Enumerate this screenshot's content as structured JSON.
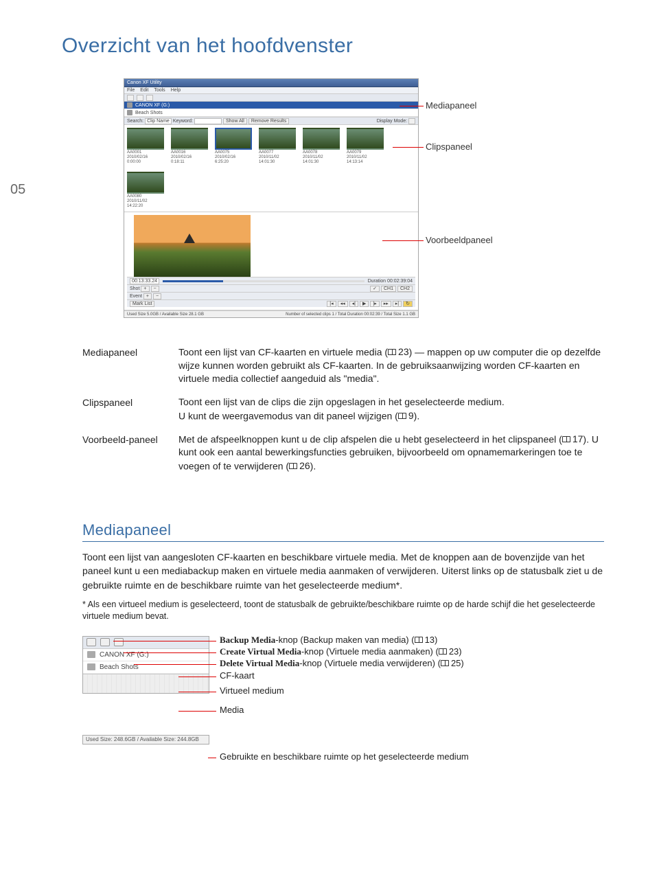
{
  "page": {
    "title": "Overzicht van het hoofdvenster",
    "number": "05"
  },
  "figure": {
    "callouts": {
      "media": "Mediapaneel",
      "clips": "Clipspaneel",
      "preview": "Voorbeeldpaneel"
    },
    "app": {
      "titlebar": "Canon XF Utility",
      "menu": [
        "File",
        "Edit",
        "Tools",
        "Help"
      ],
      "media_items": [
        {
          "label": "CANON XF (G:)",
          "selected": true
        },
        {
          "label": "Beach Shots",
          "selected": false
        }
      ],
      "search": {
        "label": "Search:",
        "field": "Clip Name",
        "keyword_label": "Keyword:",
        "show_all": "Show All",
        "remove": "Remove Results",
        "display": "Display Mode:"
      },
      "clips": [
        {
          "name": "AA0001",
          "date": "2010/02/16",
          "dur": "0:00:00"
        },
        {
          "name": "AA0016",
          "date": "2010/02/16",
          "dur": "0:18:11"
        },
        {
          "name": "AA0075",
          "date": "2010/02/16",
          "dur": "6:25:20",
          "sel": true
        },
        {
          "name": "AA0077",
          "date": "2010/11/02",
          "dur": "14:01:30"
        },
        {
          "name": "AA0078",
          "date": "2010/11/02",
          "dur": "14:01:30"
        },
        {
          "name": "AA0079",
          "date": "2010/11/02",
          "dur": "14:13:14"
        },
        {
          "name": "AA0080",
          "date": "2010/11/02",
          "dur": "14:22:20"
        }
      ],
      "timecode": "00:13:33.24",
      "duration": "Duration 00:02:39:04",
      "shot_label": "Shot",
      "event_label": "Event",
      "mark_list": "Mark List",
      "ch1": "CH1",
      "ch2": "CH2",
      "status_left": "Used Size 5.0GB / Available Size 28.1 GB",
      "status_right": "Number of selected clips 1 / Total Duration 00:02:39 / Total Size 1.1 GB"
    }
  },
  "definitions": {
    "media": {
      "term": "Mediapaneel",
      "pre": "Toont een lijst van CF-kaarten en virtuele media (",
      "ref": "23",
      "post": ") — mappen op uw computer die op dezelfde wijze kunnen worden gebruikt als CF-kaarten. In de gebruiksaanwijzing worden CF-kaarten en virtuele media collectief aangeduid als \"media\"."
    },
    "clips": {
      "term": "Clipspaneel",
      "line1": "Toont een lijst van de clips die zijn opgeslagen in het geselecteerde medium.",
      "line2_pre": "U kunt de weergavemodus van dit paneel wijzigen (",
      "line2_ref": "9",
      "line2_post": ")."
    },
    "preview": {
      "term": "Voorbeeld-paneel",
      "pre1": "Met de afspeelknoppen kunt u de clip afspelen die u hebt geselecteerd in het clipspaneel (",
      "ref1": "17",
      "mid": "). U kunt ook een aantal bewerkingsfuncties gebruiken, bijvoorbeeld om opnamemarkeringen toe te voegen of te verwijderen (",
      "ref2": "26",
      "post": ")."
    }
  },
  "mediapaneel": {
    "heading": "Mediapaneel",
    "body": "Toont een lijst van aangesloten CF-kaarten en beschikbare virtuele media. Met de knoppen aan de bovenzijde van het paneel kunt u een mediabackup maken en virtuele media aanmaken of verwijderen. Uiterst links op de statusbalk ziet u de gebruikte ruimte en de beschikbare ruimte van het geselecteerde medium*.",
    "note": "* Als een virtueel medium is geselecteerd, toont de statusbalk de gebruikte/beschikbare ruimte op de harde schijf die het geselecteerde virtuele medium bevat.",
    "detail": {
      "cf_label": "CANON XF (G:)",
      "vm_label": "Beach Shots",
      "status": "Used Size: 248.6GB / Available Size: 244.8GB",
      "callouts": {
        "backup_name": "Backup Media",
        "backup_rest": "-knop (Backup maken van media) (",
        "backup_ref": "13",
        "backup_end": ")",
        "create_name": "Create Virtual Media",
        "create_rest": "-knop (Virtuele media aanmaken) (",
        "create_ref": "23",
        "create_end": ")",
        "delete_name": "Delete Virtual Media",
        "delete_rest": "-knop (Virtuele media verwijderen) (",
        "delete_ref": "25",
        "delete_end": ")",
        "cf": "CF-kaart",
        "vm": "Virtueel medium",
        "media": "Media",
        "status": "Gebruikte en beschikbare ruimte op het geselecteerde medium"
      }
    }
  }
}
